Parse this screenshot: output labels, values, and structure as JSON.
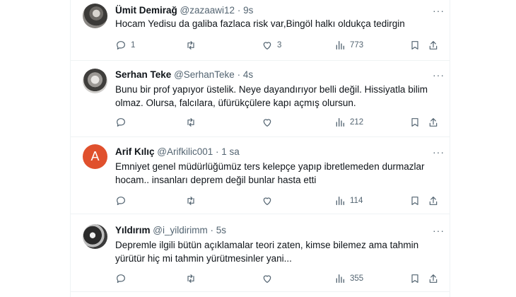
{
  "tweets": [
    {
      "name": "Ümit Demirağ",
      "handle": "@zazaawi12",
      "time": "9s",
      "avatar": "photo",
      "text_lines": [
        "Hocam Yedisu da galiba fazlaca risk var,Bingöl halkı oldukça tedirgin"
      ],
      "replies": "1",
      "retweets": "",
      "likes": "3",
      "views": "773"
    },
    {
      "name": "Serhan Teke",
      "handle": "@SerhanTeke",
      "time": "4s",
      "avatar": "photo",
      "text_lines": [
        "Bunu bir prof yapıyor üstelik. Neye dayandırıyor belli değil. Hissiyatla bilim",
        "olmaz. Olursa, falcılara, üfürükçülere kapı açmış olursun."
      ],
      "replies": "",
      "retweets": "",
      "likes": "",
      "views": "212"
    },
    {
      "name": "Arif Kılıç",
      "handle": "@Arifkilic001",
      "time": "1 sa",
      "avatar_letter": "A",
      "text_lines": [
        "Emniyet genel müdürlüğümüz ters kelepçe yapıp ibretlemeden durmazlar",
        "hocam.. insanları deprem değil bunlar hasta etti"
      ],
      "replies": "",
      "retweets": "",
      "likes": "",
      "views": "114"
    },
    {
      "name": "Yıldırım",
      "handle": "@i_yildirimm",
      "time": "5s",
      "avatar": "photo",
      "text_lines": [
        "Depremle ilgili bütün açıklamalar teori zaten, kimse bilemez ama tahmin",
        "yürütür hiç mi tahmin yürütmesinler yani..."
      ],
      "replies": "",
      "retweets": "",
      "likes": "",
      "views": "355"
    }
  ],
  "icons": {
    "reply": "reply-icon",
    "retweet": "retweet-icon",
    "like": "like-icon",
    "views": "views-icon",
    "bookmark": "bookmark-icon",
    "share": "share-icon",
    "more": "more-icon"
  },
  "separator": "·",
  "more_glyph": "···",
  "colors": {
    "text": "#0f1419",
    "muted": "#536471",
    "avatar_letter_bg": "#e0502d"
  }
}
